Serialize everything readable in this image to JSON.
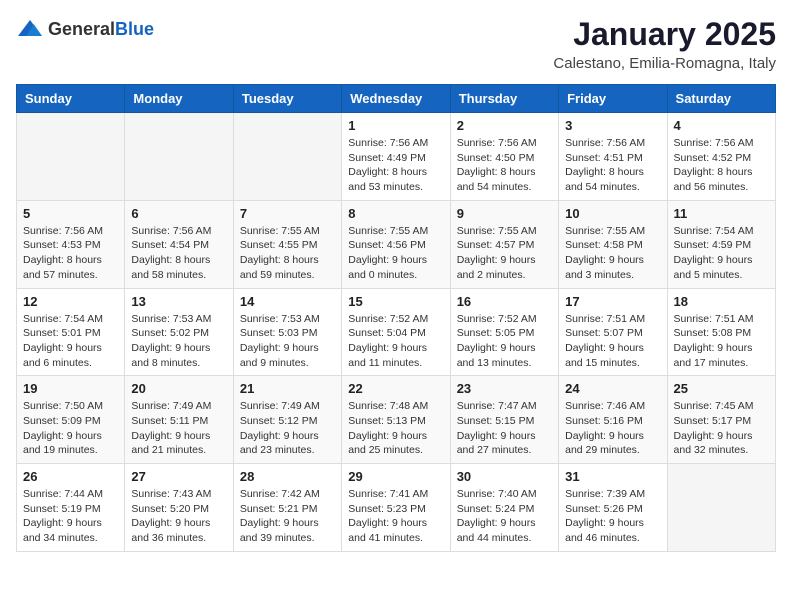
{
  "logo": {
    "general": "General",
    "blue": "Blue"
  },
  "header": {
    "month_year": "January 2025",
    "location": "Calestano, Emilia-Romagna, Italy"
  },
  "weekdays": [
    "Sunday",
    "Monday",
    "Tuesday",
    "Wednesday",
    "Thursday",
    "Friday",
    "Saturday"
  ],
  "weeks": [
    [
      {
        "day": "",
        "info": ""
      },
      {
        "day": "",
        "info": ""
      },
      {
        "day": "",
        "info": ""
      },
      {
        "day": "1",
        "info": "Sunrise: 7:56 AM\nSunset: 4:49 PM\nDaylight: 8 hours and 53 minutes."
      },
      {
        "day": "2",
        "info": "Sunrise: 7:56 AM\nSunset: 4:50 PM\nDaylight: 8 hours and 54 minutes."
      },
      {
        "day": "3",
        "info": "Sunrise: 7:56 AM\nSunset: 4:51 PM\nDaylight: 8 hours and 54 minutes."
      },
      {
        "day": "4",
        "info": "Sunrise: 7:56 AM\nSunset: 4:52 PM\nDaylight: 8 hours and 56 minutes."
      }
    ],
    [
      {
        "day": "5",
        "info": "Sunrise: 7:56 AM\nSunset: 4:53 PM\nDaylight: 8 hours and 57 minutes."
      },
      {
        "day": "6",
        "info": "Sunrise: 7:56 AM\nSunset: 4:54 PM\nDaylight: 8 hours and 58 minutes."
      },
      {
        "day": "7",
        "info": "Sunrise: 7:55 AM\nSunset: 4:55 PM\nDaylight: 8 hours and 59 minutes."
      },
      {
        "day": "8",
        "info": "Sunrise: 7:55 AM\nSunset: 4:56 PM\nDaylight: 9 hours and 0 minutes."
      },
      {
        "day": "9",
        "info": "Sunrise: 7:55 AM\nSunset: 4:57 PM\nDaylight: 9 hours and 2 minutes."
      },
      {
        "day": "10",
        "info": "Sunrise: 7:55 AM\nSunset: 4:58 PM\nDaylight: 9 hours and 3 minutes."
      },
      {
        "day": "11",
        "info": "Sunrise: 7:54 AM\nSunset: 4:59 PM\nDaylight: 9 hours and 5 minutes."
      }
    ],
    [
      {
        "day": "12",
        "info": "Sunrise: 7:54 AM\nSunset: 5:01 PM\nDaylight: 9 hours and 6 minutes."
      },
      {
        "day": "13",
        "info": "Sunrise: 7:53 AM\nSunset: 5:02 PM\nDaylight: 9 hours and 8 minutes."
      },
      {
        "day": "14",
        "info": "Sunrise: 7:53 AM\nSunset: 5:03 PM\nDaylight: 9 hours and 9 minutes."
      },
      {
        "day": "15",
        "info": "Sunrise: 7:52 AM\nSunset: 5:04 PM\nDaylight: 9 hours and 11 minutes."
      },
      {
        "day": "16",
        "info": "Sunrise: 7:52 AM\nSunset: 5:05 PM\nDaylight: 9 hours and 13 minutes."
      },
      {
        "day": "17",
        "info": "Sunrise: 7:51 AM\nSunset: 5:07 PM\nDaylight: 9 hours and 15 minutes."
      },
      {
        "day": "18",
        "info": "Sunrise: 7:51 AM\nSunset: 5:08 PM\nDaylight: 9 hours and 17 minutes."
      }
    ],
    [
      {
        "day": "19",
        "info": "Sunrise: 7:50 AM\nSunset: 5:09 PM\nDaylight: 9 hours and 19 minutes."
      },
      {
        "day": "20",
        "info": "Sunrise: 7:49 AM\nSunset: 5:11 PM\nDaylight: 9 hours and 21 minutes."
      },
      {
        "day": "21",
        "info": "Sunrise: 7:49 AM\nSunset: 5:12 PM\nDaylight: 9 hours and 23 minutes."
      },
      {
        "day": "22",
        "info": "Sunrise: 7:48 AM\nSunset: 5:13 PM\nDaylight: 9 hours and 25 minutes."
      },
      {
        "day": "23",
        "info": "Sunrise: 7:47 AM\nSunset: 5:15 PM\nDaylight: 9 hours and 27 minutes."
      },
      {
        "day": "24",
        "info": "Sunrise: 7:46 AM\nSunset: 5:16 PM\nDaylight: 9 hours and 29 minutes."
      },
      {
        "day": "25",
        "info": "Sunrise: 7:45 AM\nSunset: 5:17 PM\nDaylight: 9 hours and 32 minutes."
      }
    ],
    [
      {
        "day": "26",
        "info": "Sunrise: 7:44 AM\nSunset: 5:19 PM\nDaylight: 9 hours and 34 minutes."
      },
      {
        "day": "27",
        "info": "Sunrise: 7:43 AM\nSunset: 5:20 PM\nDaylight: 9 hours and 36 minutes."
      },
      {
        "day": "28",
        "info": "Sunrise: 7:42 AM\nSunset: 5:21 PM\nDaylight: 9 hours and 39 minutes."
      },
      {
        "day": "29",
        "info": "Sunrise: 7:41 AM\nSunset: 5:23 PM\nDaylight: 9 hours and 41 minutes."
      },
      {
        "day": "30",
        "info": "Sunrise: 7:40 AM\nSunset: 5:24 PM\nDaylight: 9 hours and 44 minutes."
      },
      {
        "day": "31",
        "info": "Sunrise: 7:39 AM\nSunset: 5:26 PM\nDaylight: 9 hours and 46 minutes."
      },
      {
        "day": "",
        "info": ""
      }
    ]
  ]
}
